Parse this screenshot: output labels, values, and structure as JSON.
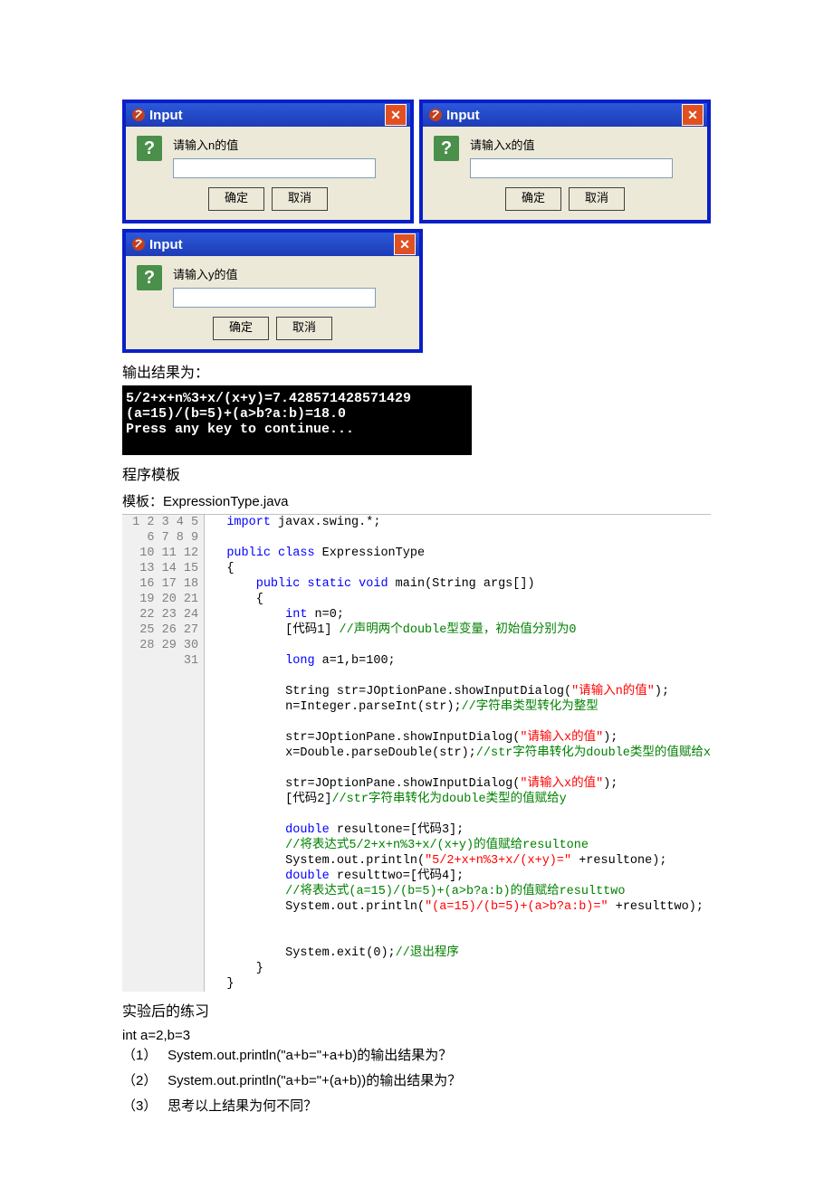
{
  "dialogs": [
    {
      "title": "Input",
      "prompt": "请输入n的值",
      "ok": "确定",
      "cancel": "取消"
    },
    {
      "title": "Input",
      "prompt": "请输入x的值",
      "ok": "确定",
      "cancel": "取消"
    },
    {
      "title": "Input",
      "prompt": "请输入y的值",
      "ok": "确定",
      "cancel": "取消"
    }
  ],
  "output_heading": "输出结果为：",
  "console_lines": [
    "5/2+x+n%3+x/(x+y)=7.428571428571429",
    "(a=15)/(b=5)+(a>b?a:b)=18.0",
    "Press any key to continue..."
  ],
  "template_heading": "程序模板",
  "template_sub": "模板：ExpressionType.java",
  "exercise_heading": "实验后的练习",
  "exercise_intro": "int a=2,b=3",
  "questions": [
    {
      "num": "（1）",
      "text": "System.out.println(\"a+b=\"+a+b)的输出结果为？"
    },
    {
      "num": "（2）",
      "text": "System.out.println(\"a+b=\"+(a+b))的输出结果为？"
    },
    {
      "num": "（3）",
      "text": "思考以上结果为何不同？"
    }
  ],
  "gutter": [
    "1",
    "2",
    "3",
    "4",
    "5",
    "6",
    "7",
    "8",
    "9",
    "10",
    "11",
    "12",
    "13",
    "14",
    "15",
    "16",
    "17",
    "18",
    "19",
    "20",
    "21",
    "22",
    "23",
    "24",
    "25",
    "26",
    "27",
    "28",
    "29",
    "30",
    "31"
  ],
  "code": {
    "l1a": "import",
    "l1b": " javax.swing.*;",
    "l3a": "public class",
    "l3b": " ExpressionType",
    "l4": "{",
    "l5a": "public static void",
    "l5b": " main(String args[])",
    "l6": "{",
    "l7a": "int",
    "l7b": " n=0;",
    "l8a": "[代码1] ",
    "l8b": "//声明两个double型变量，初始值分别为0",
    "l10a": "long",
    "l10b": " a=1,b=100;",
    "l12a": "String str=JOptionPane.showInputDialog(",
    "l12b": "\"请输入n的值\"",
    "l12c": ");",
    "l13a": "n=Integer.parseInt(str);",
    "l13b": "//字符串类型转化为整型",
    "l15a": "str=JOptionPane.showInputDialog(",
    "l15b": "\"请输入x的值\"",
    "l15c": ");",
    "l16a": "x=Double.parseDouble(str);",
    "l16b": "//str字符串转化为double类型的值赋给x",
    "l18a": "str=JOptionPane.showInputDialog(",
    "l18b": "\"请输入x的值\"",
    "l18c": ");",
    "l19a": "[代码2]",
    "l19b": "//str字符串转化为double类型的值赋给y",
    "l21a": "double",
    "l21b": " resultone=[代码3];",
    "l22": "//将表达式5/2+x+n%3+x/(x+y)的值赋给resultone",
    "l23a": "System.out.println(",
    "l23b": "\"5/2+x+n%3+x/(x+y)=\"",
    "l23c": " +resultone);",
    "l24a": "double",
    "l24b": " resulttwo=[代码4];",
    "l25": "//将表达式(a=15)/(b=5)+(a>b?a:b)的值赋给resulttwo",
    "l26a": "System.out.println(",
    "l26b": "\"(a=15)/(b=5)+(a>b?a:b)=\"",
    "l26c": " +resulttwo);",
    "l29a": "System.exit(0);",
    "l29b": "//退出程序",
    "l30": "}",
    "l31": "}"
  }
}
